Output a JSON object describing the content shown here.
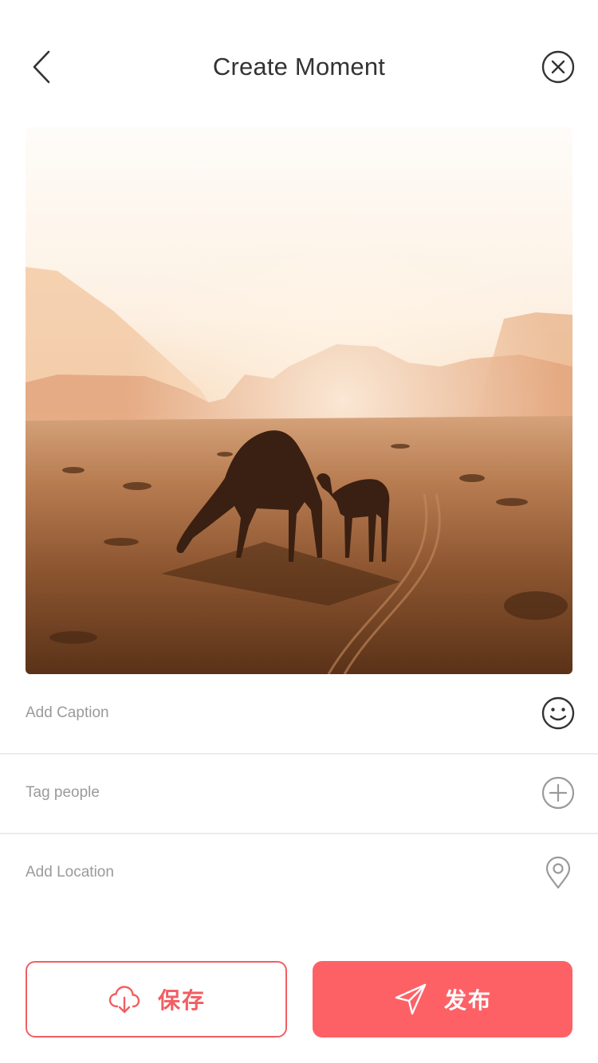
{
  "header": {
    "title": "Create Moment",
    "back_icon": "chevron-left-icon",
    "close_icon": "close-circle-icon"
  },
  "photo": {
    "subject": "camels in desert at sunset"
  },
  "form": {
    "caption": {
      "label": "Add Caption",
      "icon": "emoji-smile-icon"
    },
    "tag_people": {
      "label": "Tag people",
      "icon": "add-circle-icon"
    },
    "location": {
      "label": "Add Location",
      "icon": "location-pin-icon"
    }
  },
  "actions": {
    "save_label": "保存",
    "save_icon": "cloud-download-icon",
    "publish_label": "发布",
    "publish_icon": "send-icon"
  },
  "colors": {
    "accent": "#fd6166",
    "accent_border": "#f25e62",
    "title_text": "#333333",
    "placeholder_text": "#9a9a9a",
    "divider": "#ececec"
  }
}
